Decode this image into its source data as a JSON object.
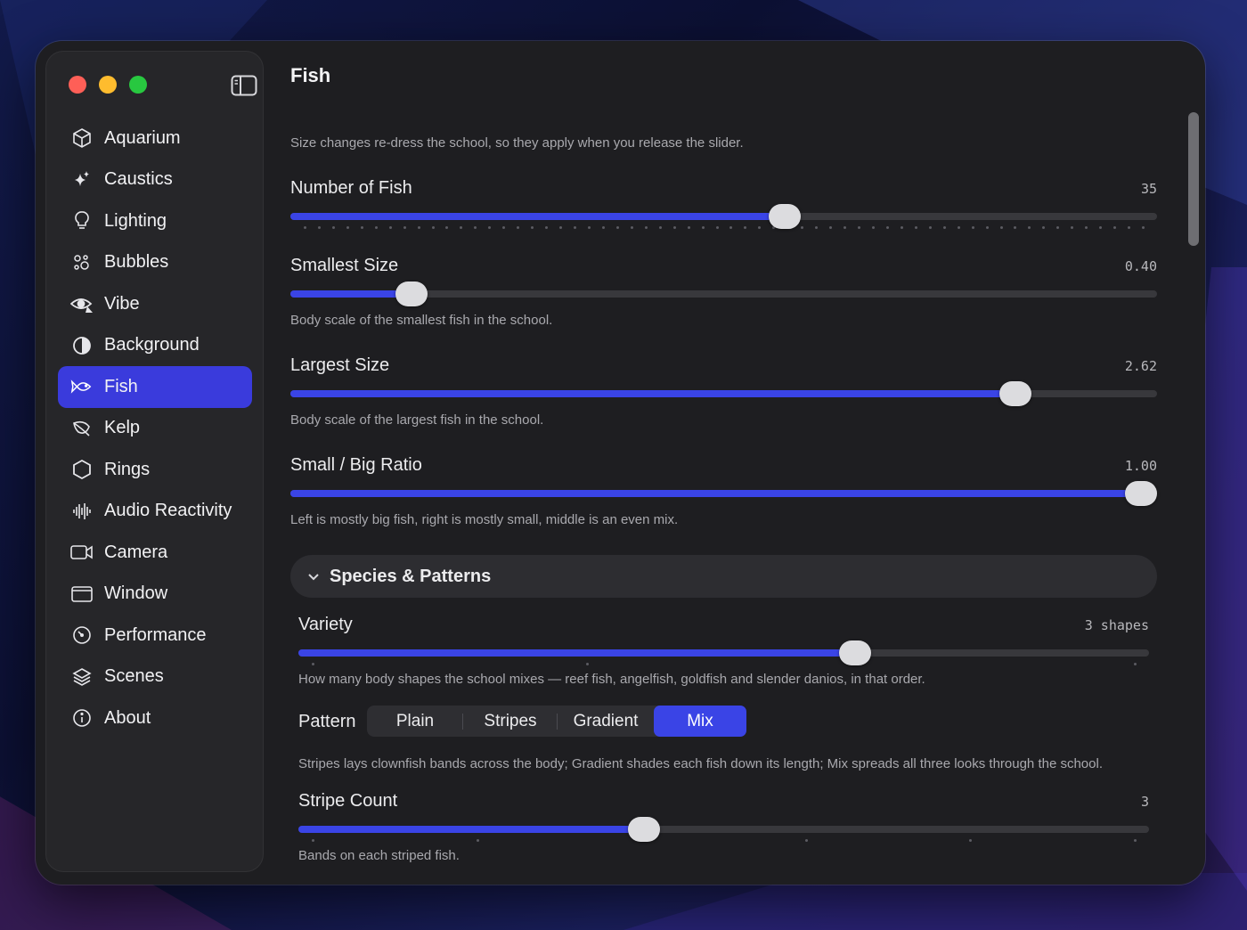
{
  "sidebar": {
    "items": [
      {
        "label": "Aquarium",
        "icon": "cube-icon"
      },
      {
        "label": "Caustics",
        "icon": "sparkles-icon"
      },
      {
        "label": "Lighting",
        "icon": "lightbulb-icon"
      },
      {
        "label": "Bubbles",
        "icon": "bubbles-icon"
      },
      {
        "label": "Vibe",
        "icon": "eye-icon"
      },
      {
        "label": "Background",
        "icon": "contrast-icon"
      },
      {
        "label": "Fish",
        "icon": "fish-icon",
        "active": true
      },
      {
        "label": "Kelp",
        "icon": "leaf-icon"
      },
      {
        "label": "Rings",
        "icon": "hexagon-icon"
      },
      {
        "label": "Audio Reactivity",
        "icon": "waveform-icon"
      },
      {
        "label": "Camera",
        "icon": "video-camera-icon"
      },
      {
        "label": "Window",
        "icon": "window-icon"
      },
      {
        "label": "Performance",
        "icon": "gauge-icon"
      },
      {
        "label": "Scenes",
        "icon": "layers-icon"
      },
      {
        "label": "About",
        "icon": "info-icon"
      }
    ]
  },
  "page": {
    "title": "Fish",
    "intro": "Size changes re-dress the school, so they apply when you release the slider."
  },
  "sliders": {
    "number_of_fish": {
      "label": "Number of Fish",
      "value": "35",
      "fraction": 0.573
    },
    "smallest_size": {
      "label": "Smallest Size",
      "value": "0.40",
      "fraction": 0.126,
      "help": "Body scale of the smallest fish in the school."
    },
    "largest_size": {
      "label": "Largest Size",
      "value": "2.62",
      "fraction": 0.849,
      "help": "Body scale of the largest fish in the school."
    },
    "ratio": {
      "label": "Small / Big Ratio",
      "value": "1.00",
      "fraction": 1.0,
      "help": "Left is mostly big fish, right is mostly small, middle is an even mix."
    }
  },
  "species": {
    "section_title": "Species & Patterns",
    "variety": {
      "label": "Variety",
      "value": "3 shapes",
      "fraction": 0.66,
      "help": "How many body shapes the school mixes — reef fish, angelfish, goldfish and slender danios, in that order."
    },
    "pattern": {
      "label": "Pattern",
      "options": [
        "Plain",
        "Stripes",
        "Gradient",
        "Mix"
      ],
      "selected": "Mix",
      "help": "Stripes lays clownfish bands across the body; Gradient shades each fish down its length; Mix spreads all three looks through the school."
    },
    "stripe_count": {
      "label": "Stripe Count",
      "value": "3",
      "fraction": 0.403,
      "help": "Bands on each striped fish."
    }
  },
  "colors": {
    "accent": "#3a44e6",
    "sidebar_active": "#3a3bdc",
    "window_bg": "#1e1e21"
  }
}
